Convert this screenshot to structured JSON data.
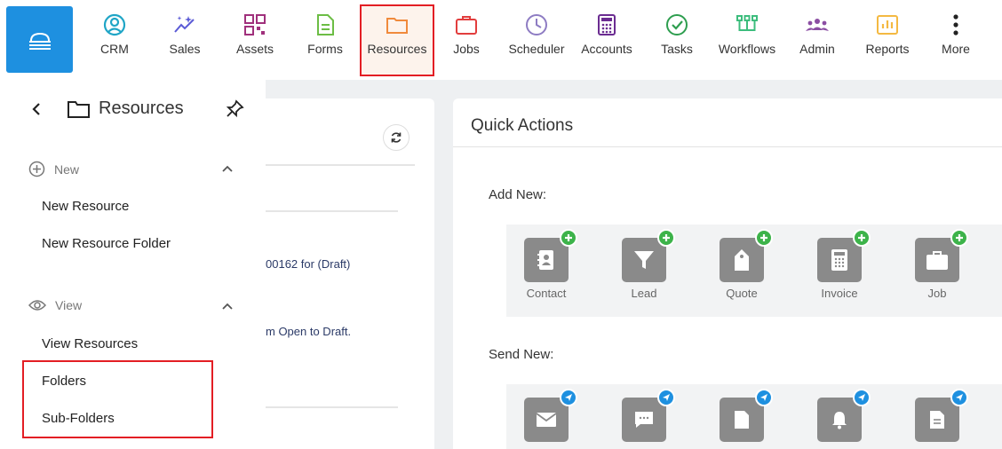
{
  "nav": {
    "items": [
      {
        "label": "CRM",
        "icon": "person-circle-icon"
      },
      {
        "label": "Sales",
        "icon": "sparkles-icon"
      },
      {
        "label": "Assets",
        "icon": "qr-code-icon"
      },
      {
        "label": "Forms",
        "icon": "document-icon"
      },
      {
        "label": "Resources",
        "icon": "folder-icon",
        "highlighted": true
      },
      {
        "label": "Jobs",
        "icon": "briefcase-icon"
      },
      {
        "label": "Scheduler",
        "icon": "clock-icon"
      },
      {
        "label": "Accounts",
        "icon": "calculator-icon"
      },
      {
        "label": "Tasks",
        "icon": "check-circle-icon"
      },
      {
        "label": "Workflows",
        "icon": "workflow-icon"
      },
      {
        "label": "Admin",
        "icon": "users-icon"
      },
      {
        "label": "Reports",
        "icon": "bar-chart-icon"
      },
      {
        "label": "More",
        "icon": "vertical-dots-icon"
      }
    ],
    "colors": {
      "crm": "#1fa5c6",
      "sales": "#5b5bd6",
      "assets": "#a0307c",
      "forms": "#6cbd45",
      "resources": "#f08a3c",
      "jobs": "#e23d3d",
      "scheduler": "#8e7cc3",
      "accounts": "#6b2c91",
      "tasks": "#2e9e4f",
      "workflows": "#3dbd7d",
      "admin": "#8b4ea3",
      "reports": "#f4b942",
      "more": "#222222"
    }
  },
  "sidebar": {
    "title": "Resources",
    "sections": [
      {
        "label": "New",
        "links": [
          "New Resource",
          "New Resource Folder"
        ]
      },
      {
        "label": "View",
        "links": [
          "View Resources",
          "Folders",
          "Sub-Folders"
        ]
      }
    ]
  },
  "middle": {
    "text1": "00162 for (Draft)",
    "text2": "m Open to Draft."
  },
  "quick_actions": {
    "title": "Quick Actions",
    "add_label": "Add New:",
    "add_items": [
      "Contact",
      "Lead",
      "Quote",
      "Invoice",
      "Job"
    ],
    "send_label": "Send New:"
  },
  "theme": {
    "accent": "#1e90e0",
    "highlight_border": "#e31e24"
  }
}
